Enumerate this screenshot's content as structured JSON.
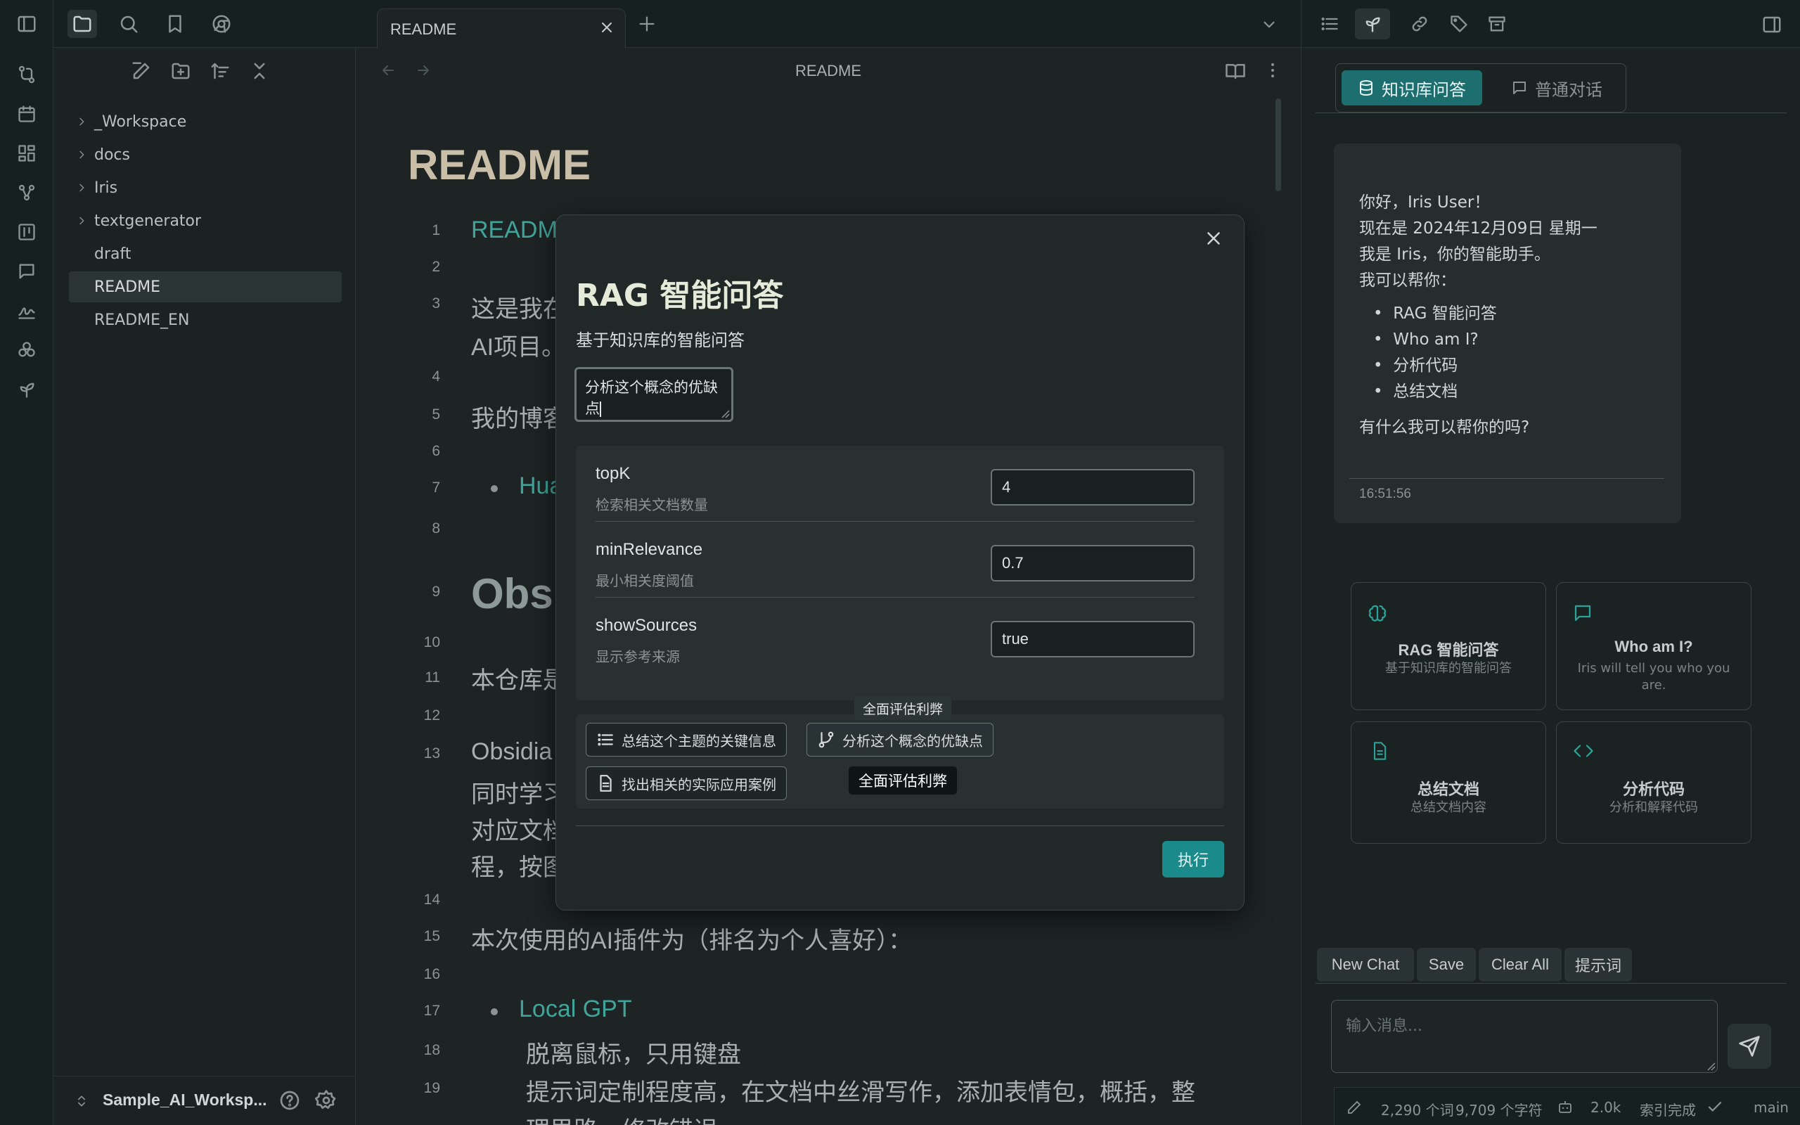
{
  "left_panel": {
    "tree": [
      {
        "label": "_Workspace",
        "folder": true
      },
      {
        "label": "docs",
        "folder": true
      },
      {
        "label": "Iris",
        "folder": true
      },
      {
        "label": "textgenerator",
        "folder": true
      },
      {
        "label": "draft",
        "folder": false
      },
      {
        "label": "README",
        "folder": false,
        "active": true
      },
      {
        "label": "README_EN",
        "folder": false
      }
    ],
    "vault_name": "Sample_AI_Worksp..."
  },
  "editor": {
    "tab_label": "README",
    "view_title": "README",
    "doc_title": "README",
    "lines": [
      {
        "n": "1",
        "text": "README"
      },
      {
        "n": "2",
        "text": ""
      },
      {
        "n": "3",
        "text": "这是我在"
      },
      {
        "n": "",
        "text": "AI项目。"
      },
      {
        "n": "4",
        "text": ""
      },
      {
        "n": "5",
        "text": "我的博客"
      },
      {
        "n": "6",
        "text": ""
      },
      {
        "n": "7",
        "text": "Hua"
      },
      {
        "n": "8",
        "text": ""
      },
      {
        "n": "9",
        "text": "Obsi"
      },
      {
        "n": "10",
        "text": ""
      },
      {
        "n": "11",
        "text": "本仓库是"
      },
      {
        "n": "12",
        "text": ""
      },
      {
        "n": "13",
        "text": "Obsidia"
      },
      {
        "n": "",
        "text": "同时学习"
      },
      {
        "n": "",
        "text": "对应文档"
      },
      {
        "n": "",
        "text": "程，按图"
      },
      {
        "n": "14",
        "text": ""
      },
      {
        "n": "15",
        "text": "本次使用的AI插件为（排名为个人喜好）："
      },
      {
        "n": "16",
        "text": ""
      },
      {
        "n": "17",
        "text": "Local GPT"
      },
      {
        "n": "18",
        "text": "脱离鼠标，只用键盘"
      },
      {
        "n": "19",
        "text": "提示词定制程度高，在文档中丝滑写作，添加表情包，概括，整"
      },
      {
        "n": "",
        "text": "理思路，修改错误"
      }
    ]
  },
  "modal": {
    "title": "RAG 智能问答",
    "subtitle": "基于知识库的智能问答",
    "query_value": "分析这个概念的优缺点",
    "params": [
      {
        "name": "topK",
        "desc": "检索相关文档数量",
        "value": "4"
      },
      {
        "name": "minRelevance",
        "desc": "最小相关度阈值",
        "value": "0.7"
      },
      {
        "name": "showSources",
        "desc": "显示参考来源",
        "value": "true"
      }
    ],
    "chips": [
      {
        "label": "总结这个主题的关键信息",
        "icon": "list-icon"
      },
      {
        "label": "分析这个概念的优缺点",
        "icon": "git-branch-icon"
      },
      {
        "label": "找出相关的实际应用案例",
        "icon": "document-icon"
      }
    ],
    "tooltip_top": "全面评估利弊",
    "tooltip_bottom": "全面评估利弊",
    "execute_label": "执行",
    "accent": "#1a8a8a"
  },
  "right_panel": {
    "tabs": [
      {
        "label": "知识库问答",
        "active": true
      },
      {
        "label": "普通对话",
        "active": false
      }
    ],
    "greeting": {
      "line1": "你好，Iris User！",
      "line2": "现在是 2024年12月09日 星期一",
      "line3": "我是 Iris，你的智能助手。",
      "line4": "我可以帮你：",
      "items": [
        "RAG 智能问答",
        "Who am I?",
        "分析代码",
        "总结文档"
      ],
      "question": "有什么我可以帮你的吗?",
      "time": "16:51:56"
    },
    "cards": [
      {
        "title": "RAG 智能问答",
        "desc": "基于知识库的智能问答",
        "icon": "brain-icon"
      },
      {
        "title": "Who am I?",
        "desc": "Iris will tell you who you are.",
        "icon": "message-icon"
      },
      {
        "title": "总结文档",
        "desc": "总结文档内容",
        "icon": "file-text-icon"
      },
      {
        "title": "分析代码",
        "desc": "分析和解释代码",
        "icon": "code-icon"
      }
    ],
    "buttons": [
      "New Chat",
      "Save",
      "Clear All",
      "提示词"
    ],
    "input_placeholder": "输入消息..."
  },
  "status_bar": {
    "words": "2,290 个词",
    "chars": "9,709 个字符",
    "tokens": "2.0k",
    "index": "索引完成",
    "branch": "main"
  }
}
